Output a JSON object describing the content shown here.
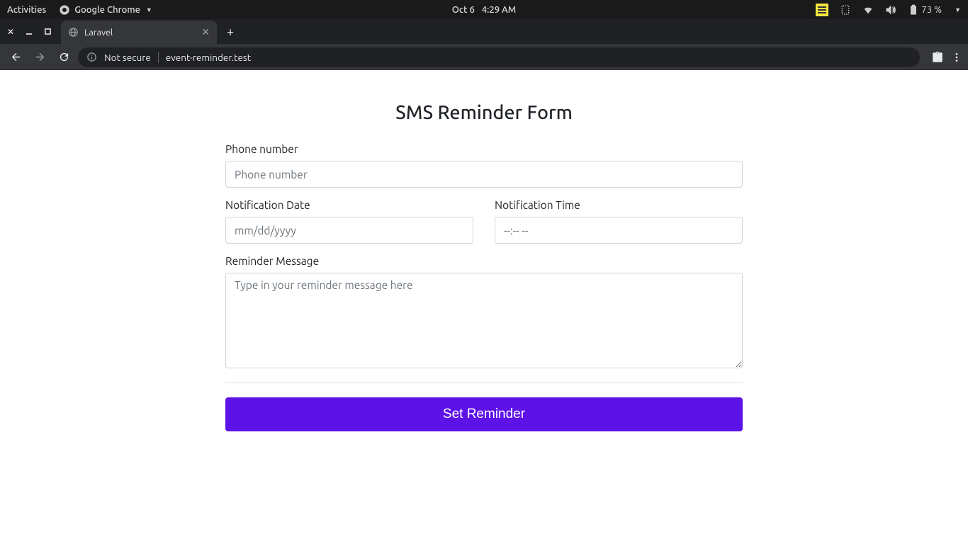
{
  "ubuntu": {
    "activities": "Activities",
    "app_name": "Google Chrome",
    "date": "Oct 6",
    "time": "4:29 AM",
    "battery": "73 %"
  },
  "browser": {
    "tab_title": "Laravel",
    "security_label": "Not secure",
    "url": "event-reminder.test"
  },
  "form": {
    "title": "SMS Reminder Form",
    "phone_label": "Phone number",
    "phone_placeholder": "Phone number",
    "date_label": "Notification Date",
    "date_placeholder": "mm/dd/yyyy",
    "time_label": "Notification Time",
    "time_placeholder": "--:-- --",
    "message_label": "Reminder Message",
    "message_placeholder": "Type in your reminder message here",
    "submit_label": "Set Reminder"
  }
}
